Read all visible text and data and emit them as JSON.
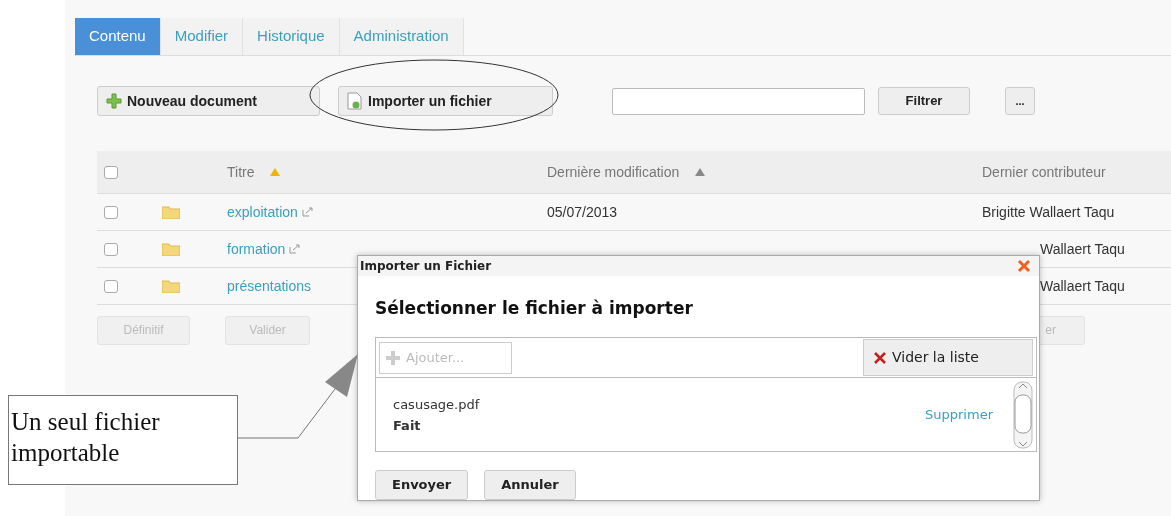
{
  "tabs": [
    {
      "label": "Contenu",
      "selected": true
    },
    {
      "label": "Modifier",
      "selected": false
    },
    {
      "label": "Historique",
      "selected": false
    },
    {
      "label": "Administration",
      "selected": false
    }
  ],
  "toolbar": {
    "buttons": [
      {
        "label": "Nouveau document",
        "kind": "new"
      },
      {
        "label": "Importer un fichier",
        "kind": "import"
      }
    ],
    "filter_button": "Filtrer",
    "more_button": "..."
  },
  "table": {
    "select_all_checked": false,
    "columns": [
      {
        "label": "Titre",
        "sortable": true,
        "sort_active": true
      },
      {
        "label": "Dernière modification",
        "sortable": true,
        "sort_active": false
      },
      {
        "label": "Dernier contributeur",
        "sortable": false
      }
    ],
    "rows": [
      {
        "title": "exploitation",
        "external_link": true,
        "checked": false,
        "modified": "05/07/2013",
        "contributor": "Brigitte Wallaert Taqu",
        "covered": false
      },
      {
        "title": "formation",
        "external_link": true,
        "checked": false,
        "contributor": "Wallaert Taqu",
        "covered": true
      },
      {
        "title": "présentations",
        "external_link": false,
        "checked": false,
        "contributor": "Wallaert Taqu",
        "covered": true
      }
    ]
  },
  "actions": [
    {
      "label": "Définitif",
      "disabled": true
    },
    {
      "label": "Valider",
      "disabled": true
    },
    {
      "label": "er",
      "disabled": true
    }
  ],
  "dialog": {
    "title": "Importer un Fichier",
    "heading": "Sélectionner le fichier à importer",
    "add_button": {
      "label": "Ajouter...",
      "disabled": true
    },
    "clear_button": "Vider la liste",
    "files": [
      {
        "name": "casusage.pdf",
        "status": "Fait",
        "remove": "Supprimer"
      }
    ],
    "buttons": [
      "Envoyer",
      "Annuler"
    ]
  },
  "annotation": {
    "text": "Un seul fichier importable"
  }
}
